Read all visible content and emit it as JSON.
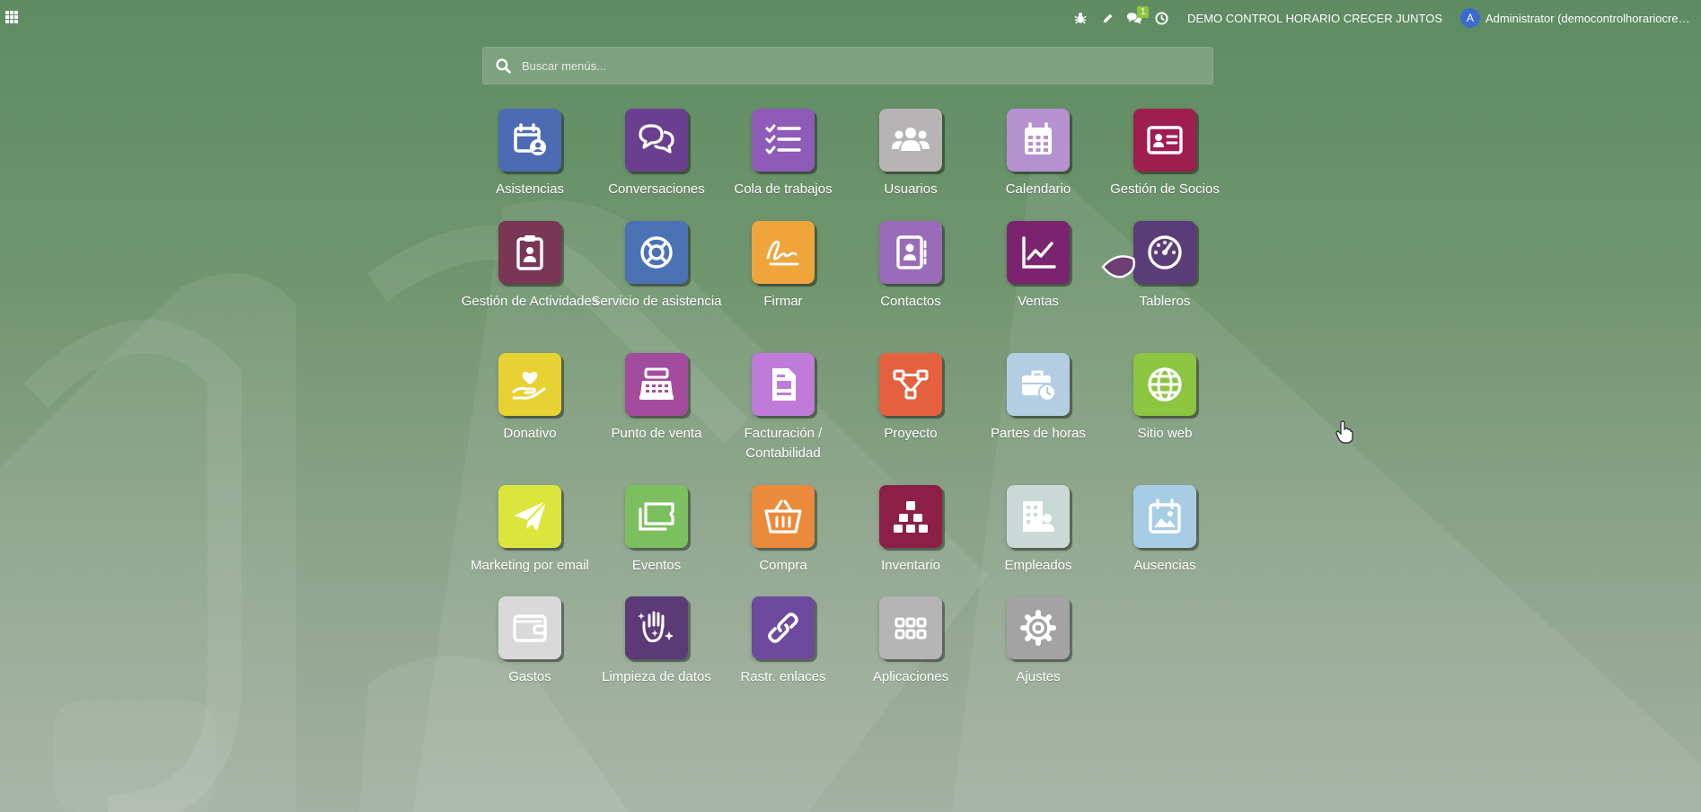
{
  "topbar": {
    "apps_menu_icon": "grid-icon",
    "debug_icon": "bug-icon",
    "edit_icon": "pencil-icon",
    "messages_icon": "chat-icon",
    "messages_count": "1",
    "activity_icon": "clock-icon",
    "company": "DEMO CONTROL HORARIO CRECER JUNTOS",
    "user_initial": "A",
    "user_name": "Administrator (democontrolhorariocrec..."
  },
  "search": {
    "placeholder": "Buscar menús..."
  },
  "apps": [
    {
      "label": "Asistencias",
      "icon": "calendar-user-icon",
      "color": "#4c6bb3"
    },
    {
      "label": "Conversaciones",
      "icon": "chat-bubbles-icon",
      "color": "#6b3f8f"
    },
    {
      "label": "Cola de trabajos",
      "icon": "checklist-icon",
      "color": "#8e5bb8"
    },
    {
      "label": "Usuarios",
      "icon": "users-icon",
      "color": "#b6b4b4"
    },
    {
      "label": "Calendario",
      "icon": "calendar-icon",
      "color": "#b592cf"
    },
    {
      "label": "Gestión de Socios",
      "icon": "id-card-icon",
      "color": "#9e1e4e"
    },
    {
      "label": "Gestión de Actividades",
      "icon": "clipboard-badge-icon",
      "color": "#7a3655"
    },
    {
      "label": "Servicio de asistencia",
      "icon": "lifebuoy-icon",
      "color": "#4b72b5"
    },
    {
      "label": "Firmar",
      "icon": "signature-icon",
      "color": "#efa53c"
    },
    {
      "label": "Contactos",
      "icon": "address-book-icon",
      "color": "#9a6bb8"
    },
    {
      "label": "Ventas",
      "icon": "trend-chart-icon",
      "color": "#7a2470"
    },
    {
      "label": "Tableros",
      "icon": "dashboard-gauge-icon",
      "color": "#5a3d78"
    },
    {
      "label": "Donativo",
      "icon": "hand-heart-icon",
      "color": "#e8d233"
    },
    {
      "label": "Punto de venta",
      "icon": "cash-register-icon",
      "color": "#a34c9d"
    },
    {
      "label": "Facturación / Contabilidad",
      "icon": "invoice-icon",
      "color": "#c07ad8"
    },
    {
      "label": "Proyecto",
      "icon": "project-nodes-icon",
      "color": "#e4603f"
    },
    {
      "label": "Partes de horas",
      "icon": "briefcase-clock-icon",
      "color": "#b3cde3"
    },
    {
      "label": "Sitio web",
      "icon": "globe-icon",
      "color": "#8cc540"
    },
    {
      "label": "Marketing por email",
      "icon": "paper-plane-icon",
      "color": "#dbe53c"
    },
    {
      "label": "Eventos",
      "icon": "ticket-icon",
      "color": "#7bbf5f"
    },
    {
      "label": "Compra",
      "icon": "basket-icon",
      "color": "#eb8a3a"
    },
    {
      "label": "Inventario",
      "icon": "boxes-icon",
      "color": "#8c1f46"
    },
    {
      "label": "Empleados",
      "icon": "building-person-icon",
      "color": "#c9dad6"
    },
    {
      "label": "Ausencias",
      "icon": "calendar-image-icon",
      "color": "#a7cde5"
    },
    {
      "label": "Gastos",
      "icon": "wallet-icon",
      "color": "#d9d9d9"
    },
    {
      "label": "Limpieza de datos",
      "icon": "sparkle-hand-icon",
      "color": "#5c3a78"
    },
    {
      "label": "Rastr. enlaces",
      "icon": "link-icon",
      "color": "#6d4a9e"
    },
    {
      "label": "Aplicaciones",
      "icon": "apps-grid-icon",
      "color": "#b5b5b5"
    },
    {
      "label": "Ajustes",
      "icon": "gear-icon",
      "color": "#a3a3a3"
    }
  ]
}
